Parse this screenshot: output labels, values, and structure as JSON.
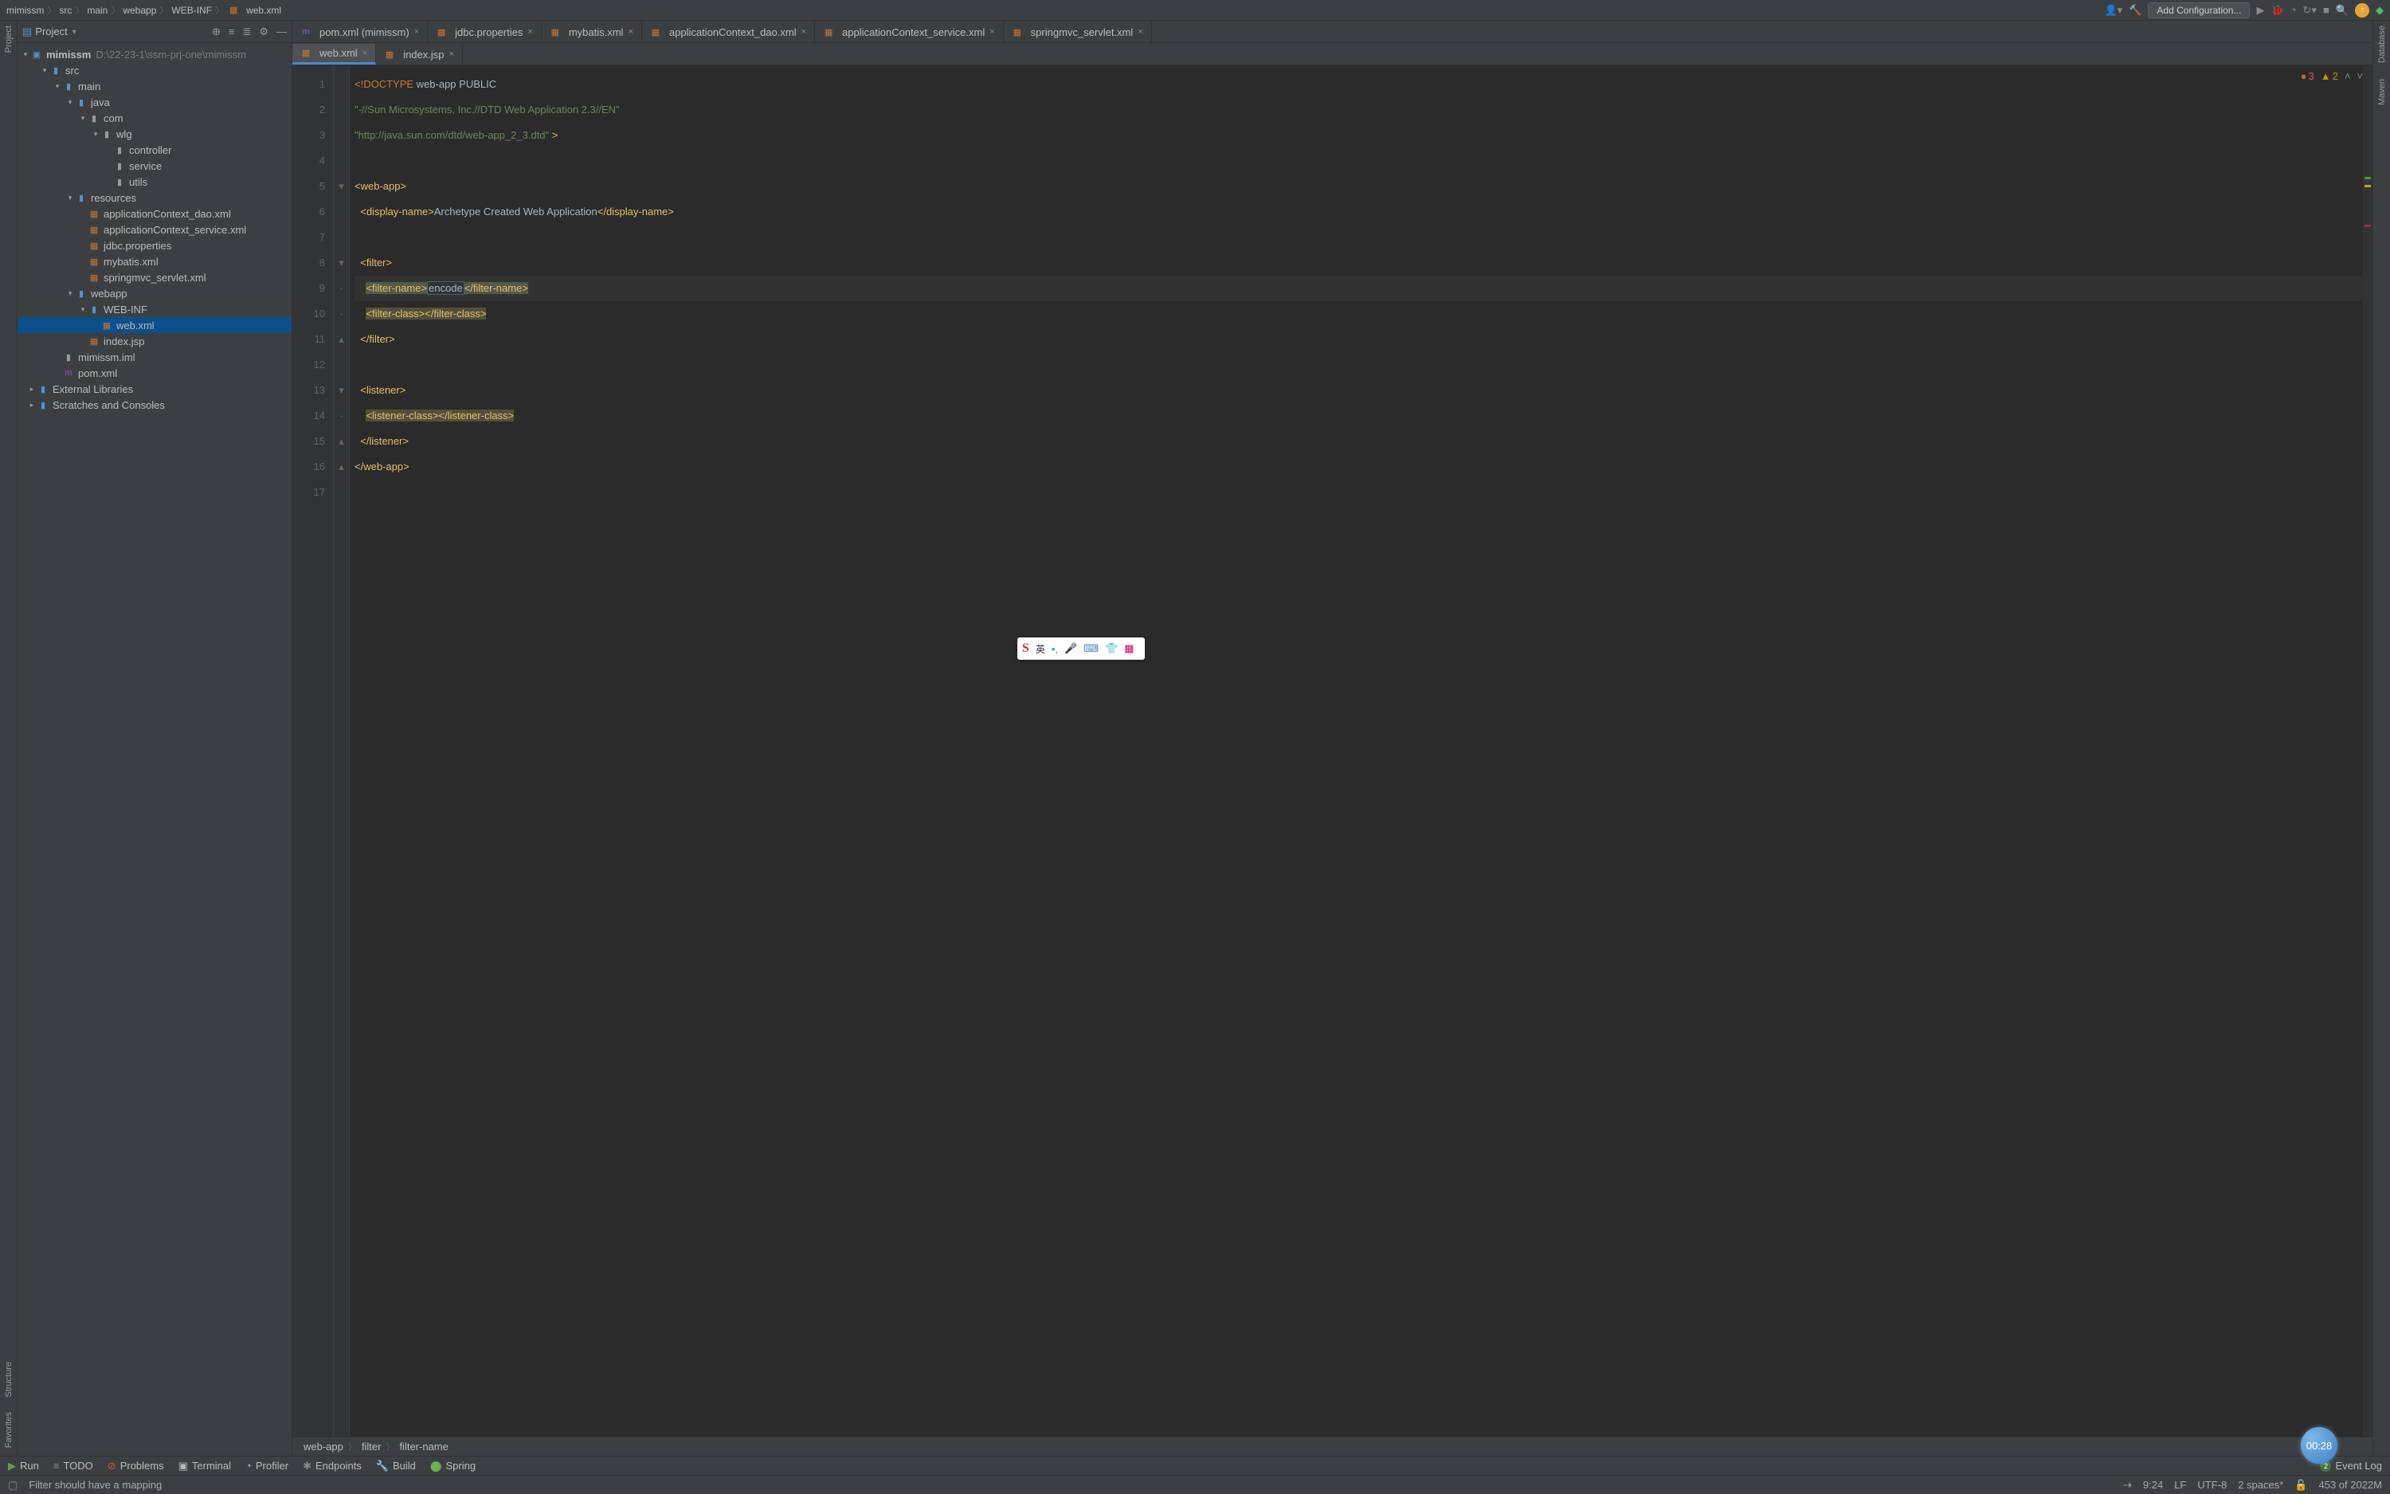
{
  "breadcrumbs": [
    "mimissm",
    "src",
    "main",
    "webapp",
    "WEB-INF",
    "web.xml"
  ],
  "topbar": {
    "config": "Add Configuration..."
  },
  "projectPane": {
    "title": "Project",
    "rootName": "mimissm",
    "rootPath": "D:\\22-23-1\\ssm-prj-one\\mimissm",
    "tree": [
      {
        "d": 1,
        "t": "src",
        "exp": true,
        "ico": "fold-blue"
      },
      {
        "d": 2,
        "t": "main",
        "exp": true,
        "ico": "fold-blue"
      },
      {
        "d": 3,
        "t": "java",
        "exp": true,
        "ico": "fold-blue"
      },
      {
        "d": 4,
        "t": "com",
        "exp": true,
        "ico": "fold-grey"
      },
      {
        "d": 5,
        "t": "wlg",
        "exp": true,
        "ico": "fold-grey"
      },
      {
        "d": 6,
        "t": "controller",
        "exp": false,
        "ico": "fold-grey",
        "leaf": true
      },
      {
        "d": 6,
        "t": "service",
        "exp": false,
        "ico": "fold-grey",
        "leaf": true
      },
      {
        "d": 6,
        "t": "utils",
        "exp": false,
        "ico": "fold-grey",
        "leaf": true
      },
      {
        "d": 3,
        "t": "resources",
        "exp": true,
        "ico": "fold-blue"
      },
      {
        "d": 4,
        "t": "applicationContext_dao.xml",
        "ico": "xml-ico",
        "leaf": true
      },
      {
        "d": 4,
        "t": "applicationContext_service.xml",
        "ico": "xml-ico",
        "leaf": true
      },
      {
        "d": 4,
        "t": "jdbc.properties",
        "ico": "xml-ico",
        "leaf": true
      },
      {
        "d": 4,
        "t": "mybatis.xml",
        "ico": "xml-ico",
        "leaf": true
      },
      {
        "d": 4,
        "t": "springmvc_servlet.xml",
        "ico": "xml-ico",
        "leaf": true
      },
      {
        "d": 3,
        "t": "webapp",
        "exp": true,
        "ico": "fold-blue"
      },
      {
        "d": 4,
        "t": "WEB-INF",
        "exp": true,
        "ico": "fold-blue"
      },
      {
        "d": 5,
        "t": "web.xml",
        "ico": "xml-ico",
        "leaf": true,
        "sel": true
      },
      {
        "d": 4,
        "t": "index.jsp",
        "ico": "jsp-ico",
        "leaf": true
      },
      {
        "d": 2,
        "t": "mimissm.iml",
        "ico": "fold-grey",
        "leaf": true
      },
      {
        "d": 2,
        "t": "pom.xml",
        "ico": "m-ico",
        "leaf": true
      },
      {
        "d": 0,
        "t": "External Libraries",
        "exp": false,
        "ico": "fold-blue",
        "chev": true
      },
      {
        "d": 0,
        "t": "Scratches and Consoles",
        "exp": false,
        "ico": "fold-blue",
        "chev": true
      }
    ]
  },
  "tabsTop": [
    {
      "label": "pom.xml (mimissm)",
      "ico": "m"
    },
    {
      "label": "jdbc.properties",
      "ico": "x"
    },
    {
      "label": "mybatis.xml",
      "ico": "x"
    },
    {
      "label": "applicationContext_dao.xml",
      "ico": "x"
    },
    {
      "label": "applicationContext_service.xml",
      "ico": "x"
    },
    {
      "label": "springmvc_servlet.xml",
      "ico": "x"
    }
  ],
  "tabsSecond": [
    {
      "label": "web.xml",
      "active": true
    },
    {
      "label": "index.jsp"
    }
  ],
  "warnings": {
    "errors": "3",
    "warns": "2"
  },
  "code": {
    "lines": [
      [
        {
          "c": "t-kw",
          "t": "<!DOCTYPE "
        },
        {
          "c": "t-txt",
          "t": "web-app "
        },
        {
          "c": "t-txt",
          "t": "PUBLIC"
        }
      ],
      [
        {
          "c": "t-str",
          "t": "\"-//Sun Microsystems, Inc.//DTD Web Application 2.3//EN\""
        }
      ],
      [
        {
          "c": "t-str",
          "t": "\"http://java.sun.com/dtd/web-app_2_3.dtd\""
        },
        {
          "c": "t-tag",
          "t": " >"
        }
      ],
      [],
      [
        {
          "c": "t-tag",
          "t": "<web-app>"
        }
      ],
      [
        {
          "c": "",
          "t": "  "
        },
        {
          "c": "t-tag",
          "t": "<display-name>"
        },
        {
          "c": "t-txt",
          "t": "Archetype Created Web Application"
        },
        {
          "c": "t-tag",
          "t": "</display-name>"
        }
      ],
      [],
      [
        {
          "c": "",
          "t": "  "
        },
        {
          "c": "t-tag",
          "t": "<filter>"
        }
      ],
      [
        {
          "c": "",
          "t": "    "
        },
        {
          "c": "t-tag t-hl",
          "t": "<filter-name>"
        },
        {
          "c": "t-txt selbox",
          "t": "encode"
        },
        {
          "c": "t-tag t-hl",
          "t": "</filter-name>"
        }
      ],
      [
        {
          "c": "",
          "t": "    "
        },
        {
          "c": "t-tag t-warn",
          "t": "<filter-class>"
        },
        {
          "c": "t-tag t-warn",
          "t": "</filter-class>"
        }
      ],
      [
        {
          "c": "",
          "t": "  "
        },
        {
          "c": "t-tag",
          "t": "</filter>"
        }
      ],
      [],
      [
        {
          "c": "",
          "t": "  "
        },
        {
          "c": "t-tag",
          "t": "<listener>"
        }
      ],
      [
        {
          "c": "",
          "t": "    "
        },
        {
          "c": "t-tag t-warn",
          "t": "<listener-class>"
        },
        {
          "c": "t-tag t-warn",
          "t": "</listener-class>"
        }
      ],
      [
        {
          "c": "",
          "t": "  "
        },
        {
          "c": "t-tag",
          "t": "</listener>"
        }
      ],
      [
        {
          "c": "t-tag",
          "t": "</web-app>"
        }
      ],
      []
    ],
    "caretLine": 9
  },
  "editorCrumbs": [
    "web-app",
    "filter",
    "filter-name"
  ],
  "bottomTools": {
    "run": "Run",
    "todo": "TODO",
    "problems": "Problems",
    "terminal": "Terminal",
    "profiler": "Profiler",
    "endpoints": "Endpoints",
    "build": "Build",
    "spring": "Spring",
    "eventLog": "Event Log",
    "eventCount": "2"
  },
  "status": {
    "msg": "Filter should have a mapping",
    "pos": "9:24",
    "le": "LF",
    "enc": "UTF-8",
    "indent": "2 spaces*",
    "mem": "453 of 2022M"
  },
  "timer": "00:28",
  "leftTools": [
    "Project",
    "Structure",
    "Favorites"
  ],
  "rightTools": [
    "Database",
    "Maven"
  ]
}
